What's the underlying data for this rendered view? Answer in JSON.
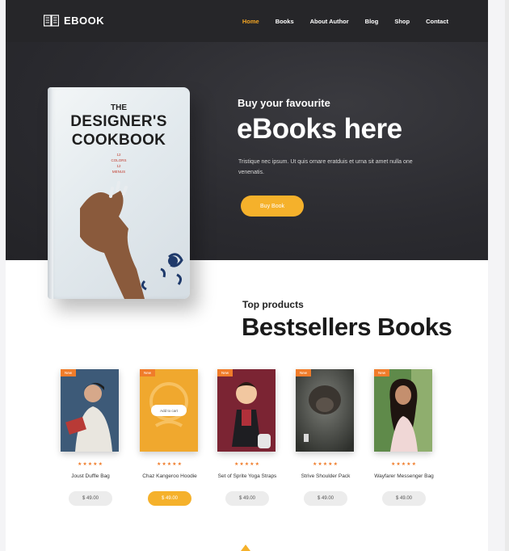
{
  "nav": {
    "logo": "EBOOK",
    "items": [
      {
        "label": "Home",
        "active": true
      },
      {
        "label": "Books",
        "active": false
      },
      {
        "label": "About Author",
        "active": false
      },
      {
        "label": "Blog",
        "active": false
      },
      {
        "label": "Shop",
        "active": false
      },
      {
        "label": "Contact",
        "active": false
      }
    ]
  },
  "hero": {
    "subtitle": "Buy your favourite",
    "title": "eBooks here",
    "description": "Tristique nec ipsum. Ut quis ornare eratduis et urna sit amet nulla one venenatis.",
    "button_label": "Buy Book",
    "book": {
      "pre": "THE",
      "line1": "DESIGNER'S",
      "line2": "COOKBOOK",
      "small": "12\nCOLORS\n12\nMENUS"
    }
  },
  "section": {
    "subtitle": "Top products",
    "title": "Bestsellers Books"
  },
  "products": [
    {
      "badge": "New",
      "stars": "★★★★★",
      "name": "Joust Duffle Bag",
      "price": "$ 49.00",
      "rating": 5
    },
    {
      "badge": "New",
      "stars": "★★★★★",
      "name": "Chaz Kangeroo Hoodie",
      "price": "$ 49.00",
      "rating": 5,
      "add_to_cart": "Add to cart"
    },
    {
      "badge": "New",
      "stars": "★★★★★",
      "name": "Set of Sprite Yoga Straps",
      "price": "$ 49.00",
      "rating": 5
    },
    {
      "badge": "New",
      "stars": "★★★★★",
      "name": "Strive Shoulder Pack",
      "price": "$ 49.00",
      "rating": 5
    },
    {
      "badge": "New",
      "stars": "★★★★★",
      "name": "Wayfarer Messenger Bag",
      "price": "$ 49.00",
      "rating": 5
    }
  ],
  "colors": {
    "accent": "#f5b12b",
    "badge": "#f07c2a",
    "active_nav": "#f5a623",
    "hero_bg": "#2b2b30"
  },
  "icons": {
    "logo": "open-book-icon",
    "scroll_top": "caret-up-icon"
  }
}
